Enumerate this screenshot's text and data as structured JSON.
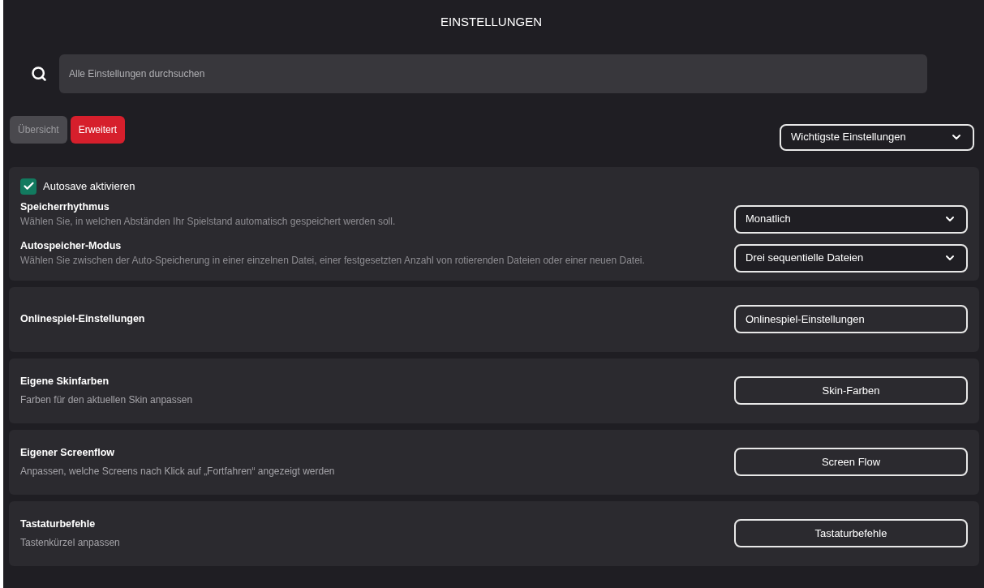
{
  "title": "EINSTELLUNGEN",
  "search": {
    "placeholder": "Alle Einstellungen durchsuchen"
  },
  "tabs": [
    {
      "label": "Übersicht",
      "selected": false
    },
    {
      "label": "Erweitert",
      "selected": true
    }
  ],
  "filter": {
    "value": "Wichtigste Einstellungen"
  },
  "sections": [
    {
      "kind": "group",
      "checkbox": {
        "label": "Autosave aktivieren",
        "checked": true
      },
      "settings": [
        {
          "title": "Speicherrhythmus",
          "description": "Wählen Sie, in welchen Abständen Ihr Spielstand automatisch gespeichert werden soll.",
          "value": "Monatlich"
        },
        {
          "title": "Autospeicher-Modus",
          "description": "Wählen Sie zwischen der Auto-Speicherung in einer einzelnen Datei, einer festgesetzten Anzahl von rotierenden Dateien oder einer neuen Datei.",
          "value": "Drei sequentielle Dateien"
        }
      ]
    },
    {
      "kind": "button",
      "title": "Onlinespiel-Einstellungen",
      "button": "Onlinespiel-Einstellungen"
    },
    {
      "kind": "button",
      "title": "Eigene Skinfarben",
      "description": "Farben für den aktuellen Skin anpassen",
      "button": "Skin-Farben"
    },
    {
      "kind": "button",
      "title": "Eigener Screenflow",
      "description": "Anpassen, welche Screens nach Klick auf „Fortfahren“ angezeigt werden",
      "button": "Screen Flow"
    },
    {
      "kind": "button",
      "title": "Tastaturbefehle",
      "description": "Tastenkürzel anpassen",
      "button": "Tastaturbefehle"
    }
  ]
}
